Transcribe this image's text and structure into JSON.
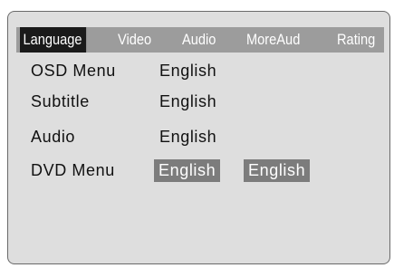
{
  "tabs": [
    {
      "label": "Language",
      "active": true
    },
    {
      "label": "Video",
      "active": false
    },
    {
      "label": "Audio",
      "active": false
    },
    {
      "label": "MoreAud",
      "active": false
    },
    {
      "label": "Rating",
      "active": false
    }
  ],
  "rows": [
    {
      "label": "OSD Menu",
      "value": "English"
    },
    {
      "label": "Subtitle",
      "value": "English"
    },
    {
      "label": "Audio",
      "value": "English"
    },
    {
      "label": "DVD Menu",
      "options": [
        "English",
        "English"
      ]
    }
  ],
  "colors": {
    "panel_bg": "#dedede",
    "tab_bar": "#9c9c9c",
    "tab_active": "#1a1a1a",
    "option_highlight": "#7c7c7c"
  }
}
